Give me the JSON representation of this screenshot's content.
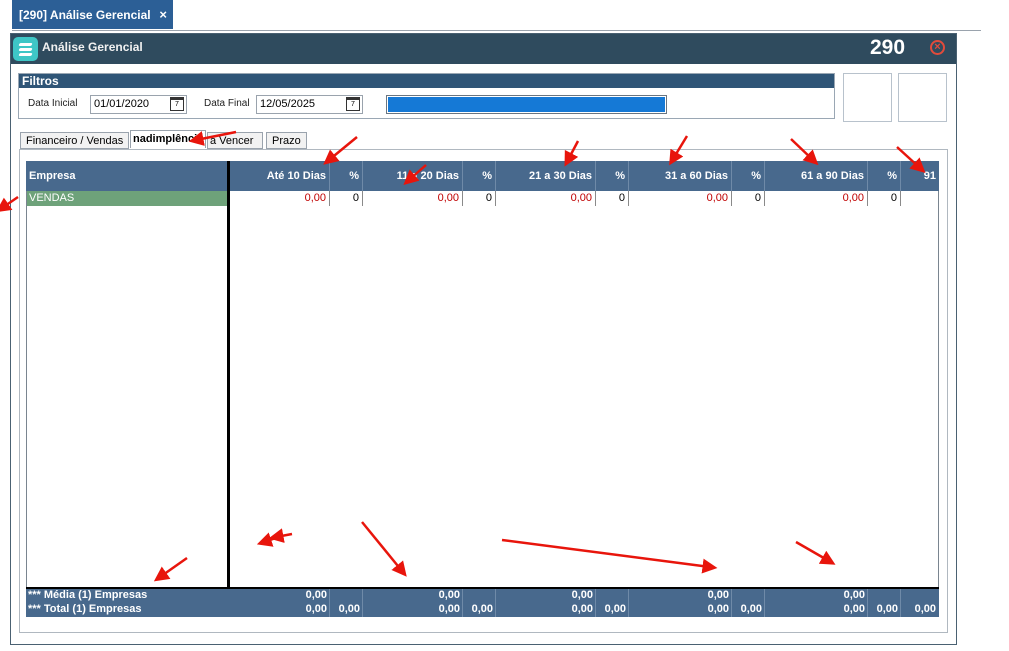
{
  "app_tab": {
    "label": "[290] Análise Gerencial",
    "close": "×"
  },
  "window": {
    "title": "Análise Gerencial",
    "number": "290"
  },
  "filters": {
    "heading": "Filtros",
    "start_label": "Data Inicial",
    "start_value": "01/01/2020",
    "end_label": "Data Final",
    "end_value": "12/05/2025",
    "calendar_glyph": "7"
  },
  "tabs": [
    {
      "label": "Financeiro / Vendas"
    },
    {
      "label": "nadimplência"
    },
    {
      "label": "à Vencer"
    },
    {
      "label": "Prazo"
    }
  ],
  "grid": {
    "headers": [
      "Empresa",
      "Até 10 Dias",
      "%",
      "11 a 20 Dias",
      "%",
      "21 a 30 Dias",
      "%",
      "31 a 60 Dias",
      "%",
      "61 a 90 Dias",
      "%",
      "91"
    ],
    "row": {
      "empresa": "VENDAS",
      "cells": [
        "0,00",
        "0",
        "0,00",
        "0",
        "0,00",
        "0",
        "0,00",
        "0",
        "0,00",
        "0"
      ]
    },
    "footer": {
      "media_label": "*** Média (1) Empresas",
      "total_label": "*** Total (1) Empresas",
      "media_values": [
        "0,00",
        "0,00",
        "0,00",
        "0,00",
        "0,00"
      ],
      "total_values": [
        "0,00",
        "0,00",
        "0,00",
        "0,00",
        "0,00",
        "0,00",
        "0,00",
        "0,00",
        "0,00",
        "0,00",
        "0,00"
      ]
    }
  },
  "colors": {
    "header_bg": "#48698d",
    "title_bg": "#2f4b5e",
    "progress": "#1579d6",
    "row_highlight": "#6ea27a",
    "value_red": "#c00000",
    "annotation_arrow": "#e8150c"
  }
}
